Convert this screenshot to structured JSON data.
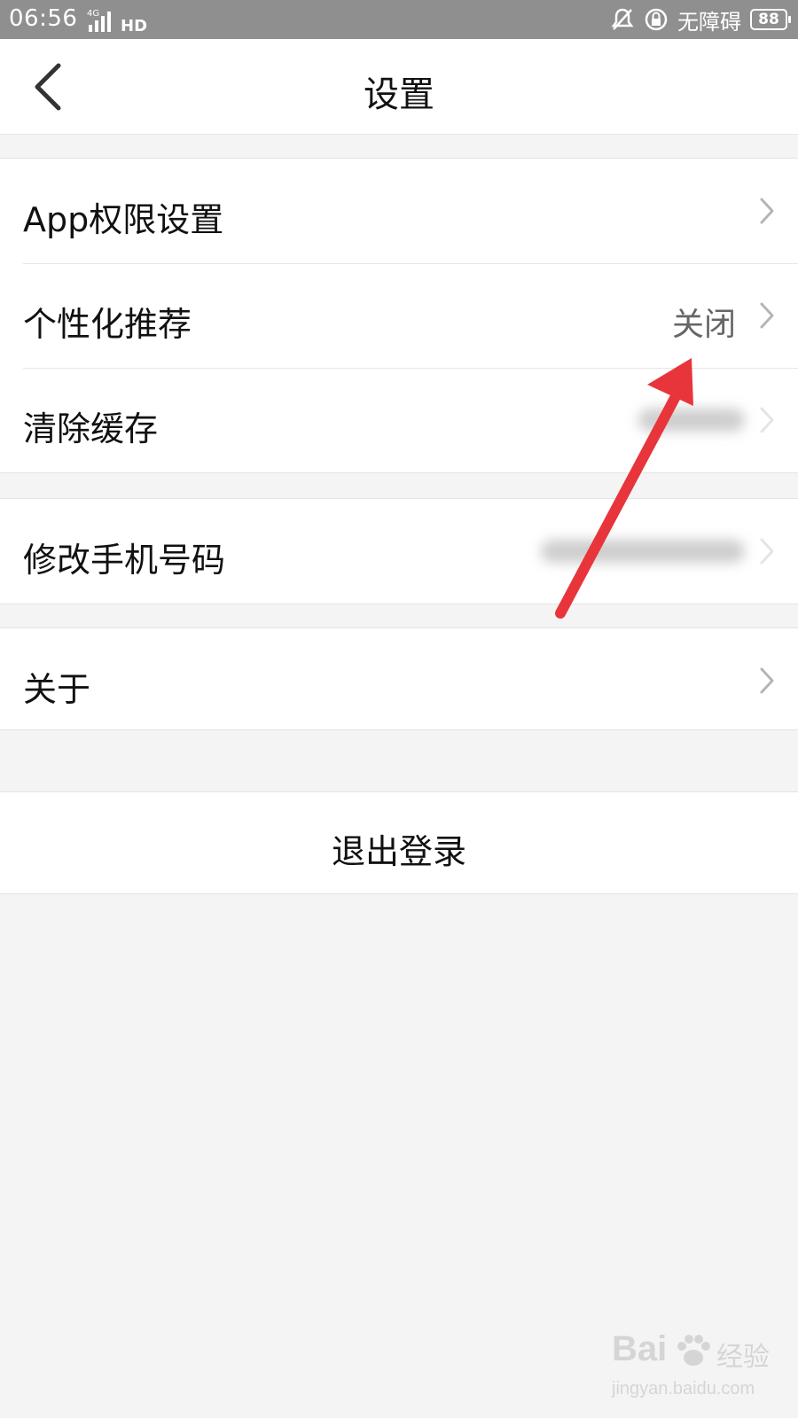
{
  "status_bar": {
    "time": "06:56",
    "network": "4G",
    "hd": "HD",
    "accessibility_label": "无障碍",
    "battery": "88"
  },
  "nav": {
    "title": "设置",
    "back_icon": "chevron-left-icon"
  },
  "groups": [
    {
      "items": [
        {
          "label": "App权限设置",
          "value": ""
        },
        {
          "label": "个性化推荐",
          "value": "关闭"
        },
        {
          "label": "清除缓存",
          "value": ""
        }
      ]
    },
    {
      "items": [
        {
          "label": "修改手机号码",
          "value": ""
        }
      ]
    },
    {
      "items": [
        {
          "label": "关于",
          "value": ""
        }
      ]
    }
  ],
  "logout": {
    "label": "退出登录"
  },
  "annotation": {
    "color": "#e8353b"
  },
  "watermark": {
    "brand": "Bai",
    "sub": "经验",
    "site": "jingyan.baidu.com"
  }
}
